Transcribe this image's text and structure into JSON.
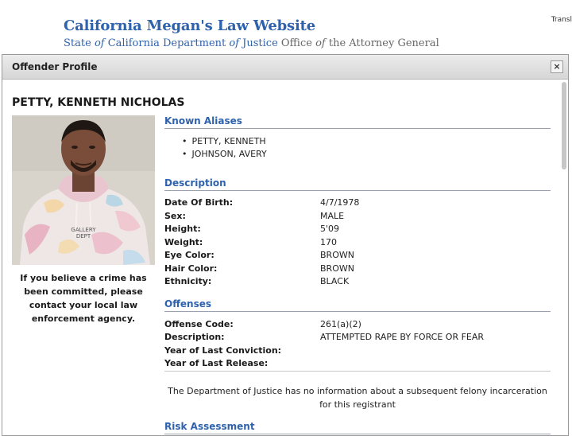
{
  "site": {
    "title": "California Megan's Law Website",
    "subtitle_part1": "State ",
    "subtitle_of1": "of",
    "subtitle_part2": " California Department ",
    "subtitle_of2": "of",
    "subtitle_part3": " Justice ",
    "subtitle_part4": "Office ",
    "subtitle_of3": "of",
    "subtitle_part5": " the Attorney General",
    "translate": "Transl"
  },
  "modal": {
    "title": "Offender Profile",
    "close_label": "×"
  },
  "offender": {
    "name": "PETTY, KENNETH NICHOLAS",
    "advisory": "If you believe a crime has been committed, please contact your local law enforcement agency.",
    "shirt_text_line1": "GALLERY",
    "shirt_text_line2": "DEPT"
  },
  "aliases": {
    "heading": "Known Aliases",
    "items": [
      "PETTY, KENNETH",
      "JOHNSON, AVERY"
    ]
  },
  "description": {
    "heading": "Description",
    "fields": [
      {
        "label": "Date Of Birth:",
        "value": "4/7/1978"
      },
      {
        "label": "Sex:",
        "value": "MALE"
      },
      {
        "label": "Height:",
        "value": "5'09"
      },
      {
        "label": "Weight:",
        "value": "170"
      },
      {
        "label": "Eye Color:",
        "value": "BROWN"
      },
      {
        "label": "Hair Color:",
        "value": "BROWN"
      },
      {
        "label": "Ethnicity:",
        "value": "BLACK"
      }
    ]
  },
  "offenses": {
    "heading": "Offenses",
    "fields": [
      {
        "label": "Offense Code:",
        "value": "261(a)(2)"
      },
      {
        "label": "Description:",
        "value": "ATTEMPTED RAPE BY FORCE OR FEAR"
      },
      {
        "label": "Year of Last Conviction:",
        "value": ""
      },
      {
        "label": "Year of Last Release:",
        "value": ""
      }
    ],
    "notice": "The Department of Justice has no information about a subsequent felony incarceration for this registrant"
  },
  "risk": {
    "heading": "Risk Assessment"
  },
  "colors": {
    "link_blue": "#2f62ad",
    "titlebar": "#dcdcdc"
  }
}
